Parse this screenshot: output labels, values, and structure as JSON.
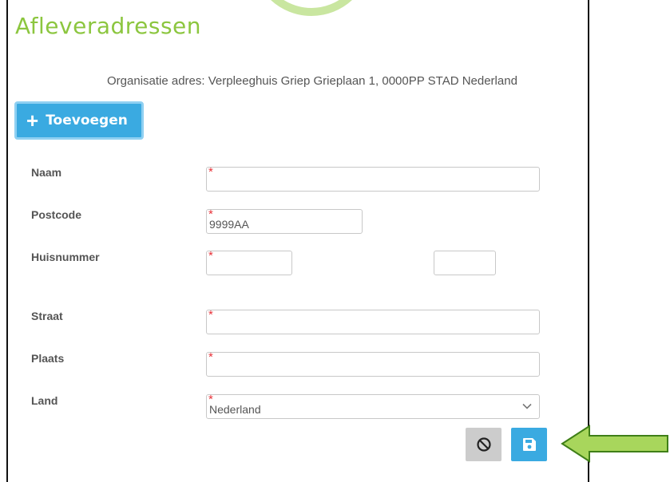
{
  "page": {
    "title": "Afleveradressen",
    "organisation_address": "Organisatie adres: Verpleeghuis Griep Grieplaan 1, 0000PP STAD Nederland"
  },
  "toolbar": {
    "add_label": "Toevoegen",
    "add_icon": "plus-icon"
  },
  "form": {
    "required_marker": "*",
    "fields": {
      "naam": {
        "label": "Naam",
        "value": ""
      },
      "postcode": {
        "label": "Postcode",
        "value": "",
        "placeholder": "9999AA"
      },
      "huisnummer": {
        "label": "Huisnummer",
        "value": "",
        "addition_value": ""
      },
      "straat": {
        "label": "Straat",
        "value": ""
      },
      "plaats": {
        "label": "Plaats",
        "value": ""
      },
      "land": {
        "label": "Land",
        "selected": "Nederland"
      }
    }
  },
  "actions": {
    "cancel_icon": "ban-icon",
    "save_icon": "floppy-disk-icon"
  },
  "colors": {
    "title": "#8cc63f",
    "primary": "#3aaae1",
    "required": "#e8333a",
    "pointer_arrow": "#a8d65c"
  }
}
